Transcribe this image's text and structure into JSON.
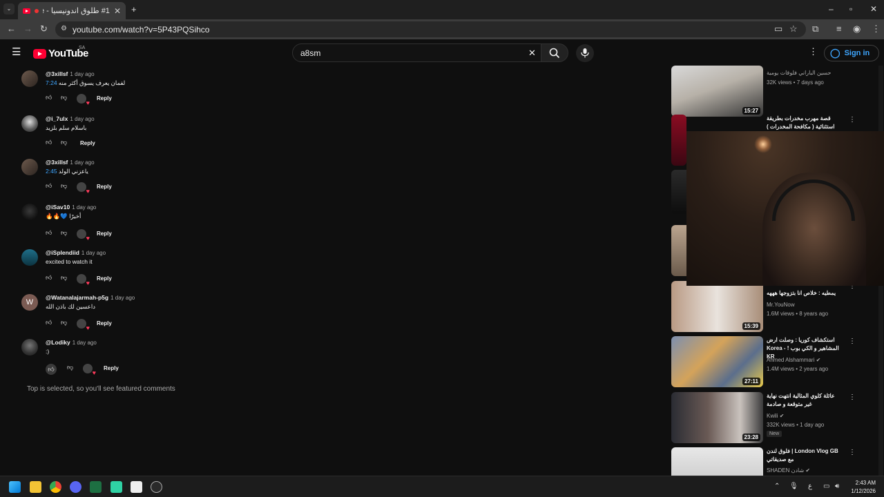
{
  "browser": {
    "tab_title": "#1 طلوق اندونيسيا - YouTube",
    "url": "youtube.com/watch?v=5P43PQSihco"
  },
  "header": {
    "logo_text": "YouTube",
    "country_code": "SA",
    "search_value": "a8sm",
    "signin_label": "Sign in"
  },
  "comments": [
    {
      "author": "@3xillsf",
      "time": "1 day ago",
      "link": "7:24",
      "text": "لفمان يعرف يسوق أكثر منه",
      "reply": "Reply"
    },
    {
      "author": "@i_7ulx",
      "time": "1 day ago",
      "link": "",
      "text": "باسلام سلم بلزيد",
      "reply": "Reply"
    },
    {
      "author": "@3xillsf",
      "time": "1 day ago",
      "link": "2:45",
      "text": "ياعزني الولد",
      "reply": "Reply"
    },
    {
      "author": "@iSav10",
      "time": "1 day ago",
      "link": "",
      "text": "أخيرًا 💙🔥🔥",
      "reply": "Reply"
    },
    {
      "author": "@iSplendiid",
      "time": "1 day ago",
      "link": "",
      "text": "excited to watch it",
      "reply": "Reply"
    },
    {
      "author": "@Watanalajarmah-p5g",
      "time": "1 day ago",
      "link": "",
      "text": "داعسين لك باذن الله",
      "reply": "Reply"
    },
    {
      "author": "@Lodiky",
      "time": "1 day ago",
      "link": "",
      "text": ":)",
      "reply": "Reply"
    }
  ],
  "footer_note": "Top is selected, so you'll see featured comments",
  "sidebar": [
    {
      "title": "",
      "channel": "حسين الباراني فلوقات يومية",
      "views": "32K views • 7 days ago",
      "duration": "15:27",
      "new": ""
    },
    {
      "title": "قصة مهرب مخدرات بطريقة استثنائية ( مكافحة المخدرات ) 💔",
      "channel": "",
      "views": "",
      "duration": "",
      "new": ""
    },
    {
      "title": "يمطيه : خلاص انا بتزوجها هههه",
      "channel": "Mr.YouNow",
      "views": "1.6M views • 8 years ago",
      "duration": "15:39",
      "new": ""
    },
    {
      "title": "استكشاف كوريا : وصلت ارض المشاهير و الكي بوب ! - Korea KR",
      "channel": "Ahmed Alshammari",
      "views": "1.4M views • 2 years ago",
      "duration": "27:11",
      "new": ""
    },
    {
      "title": "عائلة كلوي المثالية انتهت نهاية غير متوقعة و صادمة",
      "channel": "Kwili",
      "views": "332K views • 1 day ago",
      "duration": "23:28",
      "new": "New"
    },
    {
      "title": "London Vlog GB | فلوق لندن مع صديقاتي",
      "channel": "SHADEN شادن",
      "views": "",
      "duration": "",
      "new": ""
    }
  ],
  "taskbar": {
    "time": "2:43 AM",
    "date": "1/12/2026",
    "lang": "ع"
  }
}
